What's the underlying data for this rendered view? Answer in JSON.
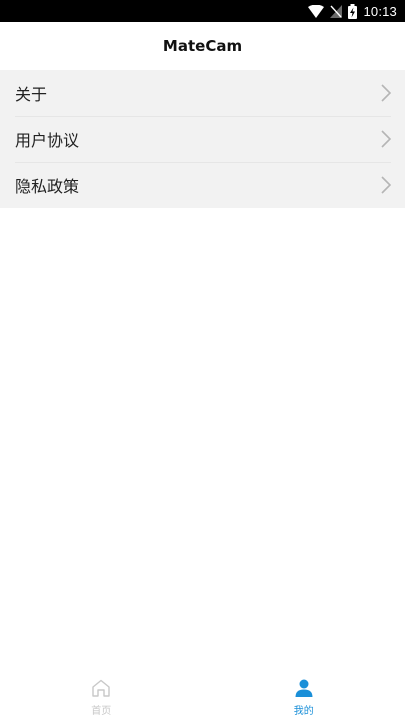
{
  "status_bar": {
    "time": "10:13",
    "icons": [
      "wifi-icon",
      "no-signal-icon",
      "battery-charging-icon"
    ]
  },
  "header": {
    "title": "MateCam"
  },
  "menu": {
    "items": [
      {
        "label": "关于",
        "icon": "chevron-right-icon"
      },
      {
        "label": "用户协议",
        "icon": "chevron-right-icon"
      },
      {
        "label": "隐私政策",
        "icon": "chevron-right-icon"
      }
    ]
  },
  "tabs": [
    {
      "label": "首页",
      "icon": "home-icon",
      "active": false
    },
    {
      "label": "我的",
      "icon": "user-icon",
      "active": true
    }
  ],
  "colors": {
    "accent": "#1a8fd8",
    "inactive": "#c8c8c8",
    "list_background": "#f2f2f2",
    "status_bar": "#000000"
  }
}
